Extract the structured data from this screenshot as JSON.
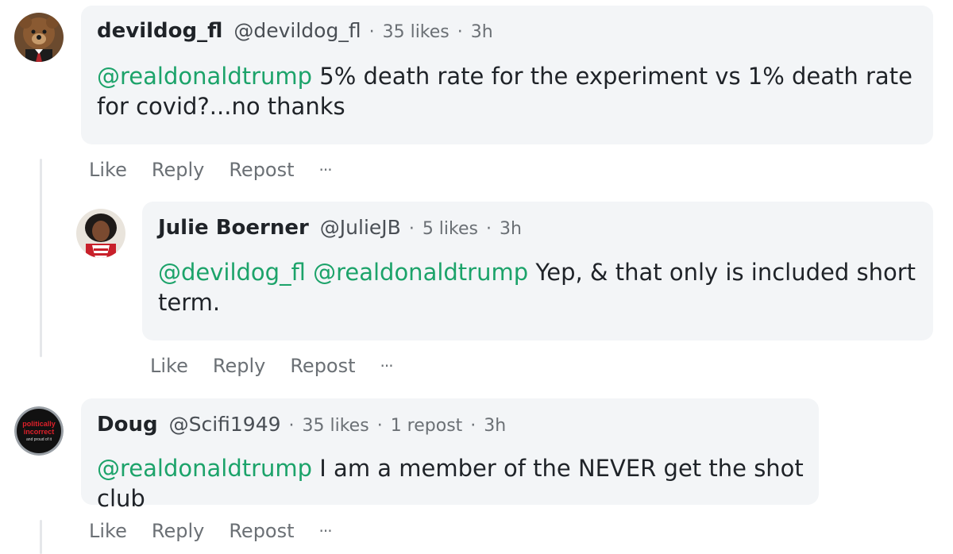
{
  "comments": [
    {
      "name": "devildog_fl",
      "handle": "@devildog_fl",
      "likes": "35 likes",
      "time": "3h",
      "mention": "@realdonaldtrump",
      "text": " 5% death rate for the experiment vs 1% death rate for covid?...no thanks",
      "actions": {
        "like": "Like",
        "reply": "Reply",
        "repost": "Repost",
        "more": "···"
      }
    },
    {
      "name": "Julie Boerner",
      "handle": "@JulieJB",
      "likes": "5 likes",
      "time": "3h",
      "mention1": "@devildog_fl",
      "mention2": "@realdonaldtrump",
      "text": " Yep, & that only is included short term.",
      "actions": {
        "like": "Like",
        "reply": "Reply",
        "repost": "Repost",
        "more": "···"
      }
    },
    {
      "name": "Doug",
      "handle": "@Scifi1949",
      "likes": "35 likes",
      "reposts": "1 repost",
      "time": "3h",
      "mention": "@realdonaldtrump",
      "text": " I am a member of the NEVER get the shot club",
      "avatar_text": [
        "politically",
        "incorrect",
        "and proud of it"
      ],
      "actions": {
        "like": "Like",
        "reply": "Reply",
        "repost": "Repost",
        "more": "···"
      }
    }
  ],
  "dot": "·"
}
